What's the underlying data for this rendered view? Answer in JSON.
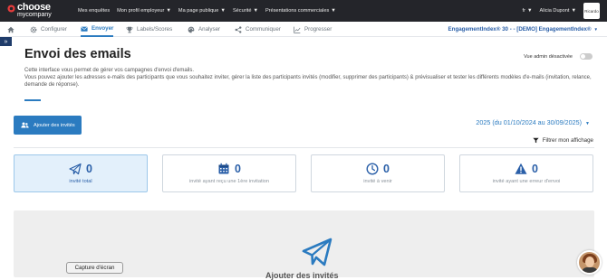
{
  "topbar": {
    "logo_line1": "choose",
    "logo_line2": "mycompany",
    "nav": [
      {
        "label": "Mes enquêtes",
        "has_caret": false
      },
      {
        "label": "Mon profil employeur",
        "has_caret": true
      },
      {
        "label": "Ma page publique",
        "has_caret": true
      },
      {
        "label": "Sécurité",
        "has_caret": true
      },
      {
        "label": "Présentations commerciales",
        "has_caret": true
      }
    ],
    "lang": "fr",
    "user": "Alicia Dupont",
    "user_tile": "Ricardo"
  },
  "tabs": [
    {
      "label": "",
      "icon": "home-icon"
    },
    {
      "label": "Configurer",
      "icon": "gear-icon"
    },
    {
      "label": "Envoyer",
      "icon": "envelope-icon",
      "active": true
    },
    {
      "label": "Labels/Scores",
      "icon": "trophy-icon"
    },
    {
      "label": "Analyser",
      "icon": "palette-icon"
    },
    {
      "label": "Communiquer",
      "icon": "share-icon"
    },
    {
      "label": "Progresser",
      "icon": "chart-line-icon"
    }
  ],
  "engagement_selector": "EngagementIndex® 30 - - [DEMO] EngagementIndex®",
  "page": {
    "title": "Envoi des emails",
    "admin_label": "Vue admin désactivée",
    "description_1": "Cette interface vous permet de gérer vos campagnes d'envoi d'emails.",
    "description_2": "Vous pouvez ajouter les adresses e-mails des participants que vous souhaitez inviter, gérer la liste des participants invités (modifier, supprimer des participants) & prévisualiser et tester les différents modèles d'e-mails (invitation, relance, demande de réponse).",
    "add_button": "Ajouter des invités",
    "period": "2025 (du 01/10/2024 au 30/09/2025)",
    "filter": "Filtrer mon affichage"
  },
  "stats": [
    {
      "value": "0",
      "label": "invité total",
      "icon": "paper-plane-icon",
      "active": true
    },
    {
      "value": "0",
      "label": "invité ayant reçu une 1ère invitation",
      "icon": "calendar-icon",
      "active": false
    },
    {
      "value": "0",
      "label": "invité à venir",
      "icon": "clock-icon",
      "active": false
    },
    {
      "value": "0",
      "label": "invité ayant une erreur d'envoi",
      "icon": "warning-icon",
      "active": false
    }
  ],
  "panel": {
    "title": "Ajouter des invités"
  },
  "capture_button": "Capture d'écran",
  "colors": {
    "accent": "#2b7bc0",
    "topbar": "#24252a",
    "stat_number": "#2a5fa8"
  }
}
